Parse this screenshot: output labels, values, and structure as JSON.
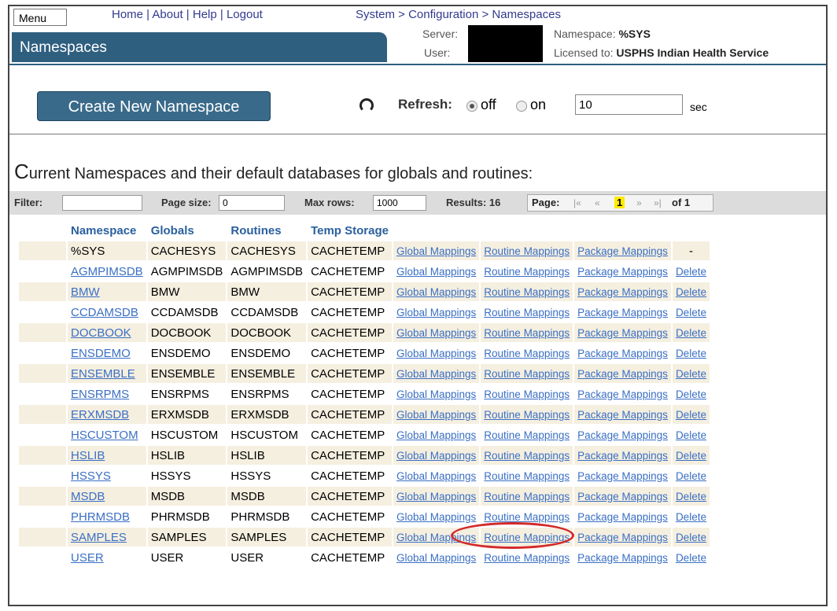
{
  "header": {
    "menu_label": "Menu",
    "links": [
      "Home",
      "About",
      "Help",
      "Logout"
    ],
    "separator": " | ",
    "breadcrumb": "System > Configuration > Namespaces",
    "title": "Namespaces",
    "server_label": "Server:",
    "user_label": "User:",
    "namespace_label": "Namespace:",
    "namespace_value": "%SYS",
    "licensed_label": "Licensed to:",
    "licensed_value": "USPHS Indian Health Service"
  },
  "toolbar": {
    "create_label": "Create New Namespace",
    "refresh_label": "Refresh:",
    "off_label": "off",
    "on_label": "on",
    "refresh_selected": "off",
    "interval_value": "10",
    "sec_label": "sec"
  },
  "heading": {
    "cap": "C",
    "rest": "urrent Namespaces and their default databases for globals and routines:"
  },
  "filterbar": {
    "filter_label": "Filter:",
    "filter_value": "",
    "page_size_label": "Page size:",
    "page_size_value": "0",
    "max_rows_label": "Max rows:",
    "max_rows_value": "1000",
    "results_label": "Results: 16",
    "page_label": "Page:",
    "first": "|«",
    "prev": "«",
    "current_page": "1",
    "next": "»",
    "last": "»|",
    "of_label": "of 1"
  },
  "table": {
    "columns": [
      "Namespace",
      "Globals",
      "Routines",
      "Temp Storage"
    ],
    "link_labels": {
      "global": "Global Mappings",
      "routine": "Routine Mappings",
      "package": "Package Mappings",
      "delete": "Delete",
      "no_delete": "-"
    },
    "rows": [
      {
        "namespace": "%SYS",
        "globals": "CACHESYS",
        "routines": "CACHESYS",
        "temp": "CACHETEMP",
        "linked": false
      },
      {
        "namespace": "AGMPIMSDB",
        "globals": "AGMPIMSDB",
        "routines": "AGMPIMSDB",
        "temp": "CACHETEMP",
        "linked": true
      },
      {
        "namespace": "BMW",
        "globals": "BMW",
        "routines": "BMW",
        "temp": "CACHETEMP",
        "linked": true
      },
      {
        "namespace": "CCDAMSDB",
        "globals": "CCDAMSDB",
        "routines": "CCDAMSDB",
        "temp": "CACHETEMP",
        "linked": true
      },
      {
        "namespace": "DOCBOOK",
        "globals": "DOCBOOK",
        "routines": "DOCBOOK",
        "temp": "CACHETEMP",
        "linked": true
      },
      {
        "namespace": "ENSDEMO",
        "globals": "ENSDEMO",
        "routines": "ENSDEMO",
        "temp": "CACHETEMP",
        "linked": true
      },
      {
        "namespace": "ENSEMBLE",
        "globals": "ENSEMBLE",
        "routines": "ENSEMBLE",
        "temp": "CACHETEMP",
        "linked": true
      },
      {
        "namespace": "ENSRPMS",
        "globals": "ENSRPMS",
        "routines": "ENSRPMS",
        "temp": "CACHETEMP",
        "linked": true
      },
      {
        "namespace": "ERXMSDB",
        "globals": "ERXMSDB",
        "routines": "ERXMSDB",
        "temp": "CACHETEMP",
        "linked": true
      },
      {
        "namespace": "HSCUSTOM",
        "globals": "HSCUSTOM",
        "routines": "HSCUSTOM",
        "temp": "CACHETEMP",
        "linked": true
      },
      {
        "namespace": "HSLIB",
        "globals": "HSLIB",
        "routines": "HSLIB",
        "temp": "CACHETEMP",
        "linked": true
      },
      {
        "namespace": "HSSYS",
        "globals": "HSSYS",
        "routines": "HSSYS",
        "temp": "CACHETEMP",
        "linked": true
      },
      {
        "namespace": "MSDB",
        "globals": "MSDB",
        "routines": "MSDB",
        "temp": "CACHETEMP",
        "linked": true
      },
      {
        "namespace": "PHRMSDB",
        "globals": "PHRMSDB",
        "routines": "PHRMSDB",
        "temp": "CACHETEMP",
        "linked": true
      },
      {
        "namespace": "SAMPLES",
        "globals": "SAMPLES",
        "routines": "SAMPLES",
        "temp": "CACHETEMP",
        "linked": true
      },
      {
        "namespace": "USER",
        "globals": "USER",
        "routines": "USER",
        "temp": "CACHETEMP",
        "linked": true
      }
    ]
  },
  "annotation_color": "#d42a2a"
}
